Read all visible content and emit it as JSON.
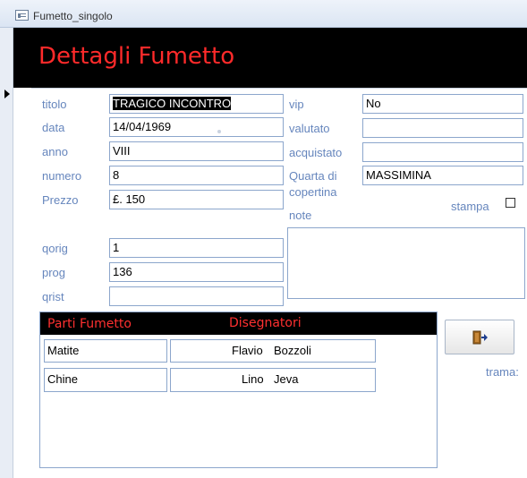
{
  "window": {
    "title": "Fumetto_singolo"
  },
  "header": {
    "title": "Dettagli Fumetto"
  },
  "fields": {
    "titolo": {
      "label": "titolo",
      "value": "TRAGICO INCONTRO"
    },
    "data": {
      "label": "data",
      "value": "14/04/1969"
    },
    "anno": {
      "label": "anno",
      "value": "VIII"
    },
    "numero": {
      "label": "numero",
      "value": "8"
    },
    "prezzo": {
      "label": "Prezzo",
      "value": "£. 150"
    },
    "qorig": {
      "label": "qorig",
      "value": "1"
    },
    "prog": {
      "label": "prog",
      "value": "136"
    },
    "qrist": {
      "label": "qrist",
      "value": ""
    },
    "vip": {
      "label": "vip",
      "value": "No"
    },
    "valutato": {
      "label": "valutato",
      "value": ""
    },
    "acquistato": {
      "label": "acquistato",
      "value": ""
    },
    "quarta": {
      "label_line1": "Quarta di",
      "label_line2": "copertina",
      "value": "MASSIMINA"
    },
    "note": {
      "label": "note",
      "value": ""
    },
    "stampa": {
      "label": "stampa",
      "checked": false
    },
    "trama": {
      "label": "trama:"
    }
  },
  "subform": {
    "col_parti": "Parti Fumetto",
    "col_disegnatori": "Disegnatori",
    "rows": [
      {
        "parte": "Matite",
        "nome": "Flavio",
        "cognome": "Bozzoli"
      },
      {
        "parte": "Chine",
        "nome": "Lino",
        "cognome": "Jeva"
      }
    ]
  },
  "buttons": {
    "exit_icon": "exit-door-icon"
  },
  "colors": {
    "header_bg": "#000000",
    "header_text": "#ff2a2a",
    "label": "#6686bd",
    "field_border": "#8ca6cc"
  }
}
